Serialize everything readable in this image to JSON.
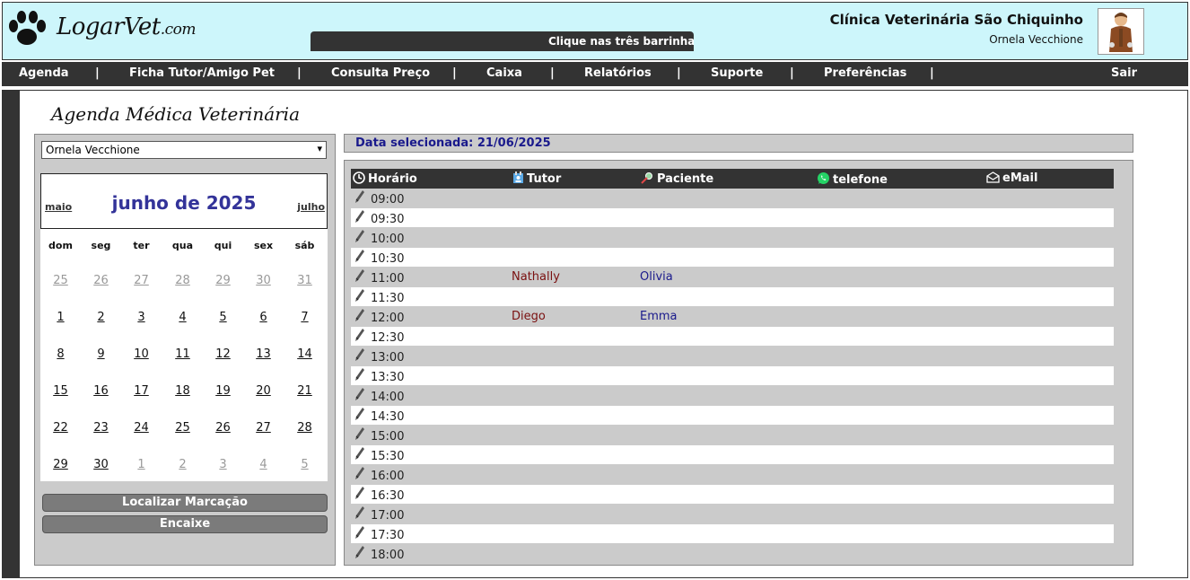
{
  "header": {
    "logo_text": "LogarVet",
    "logo_suffix": ".com",
    "ticker": "Clique nas três barrinhas pa",
    "clinic_name": "Clínica Veterinária São Chiquinho",
    "user_name": "Ornela Vecchione",
    "avatar_icon": "saint-francis-avatar"
  },
  "nav": {
    "items": [
      "Agenda",
      "Ficha Tutor/Amigo Pet",
      "Consulta Preço",
      "Caixa",
      "Relatórios",
      "Suporte",
      "Preferências"
    ],
    "separator": "|",
    "logout": "Sair"
  },
  "page": {
    "title": "Agenda Médica Veterinária"
  },
  "left": {
    "vet_selected": "Ornela Vecchione",
    "calendar": {
      "prev": "maio",
      "next": "julho",
      "title": "junho de 2025",
      "weekdays": [
        "dom",
        "seg",
        "ter",
        "qua",
        "qui",
        "sex",
        "sáb"
      ],
      "weeks": [
        [
          "25",
          "26",
          "27",
          "28",
          "29",
          "30",
          "31"
        ],
        [
          "1",
          "2",
          "3",
          "4",
          "5",
          "6",
          "7"
        ],
        [
          "8",
          "9",
          "10",
          "11",
          "12",
          "13",
          "14"
        ],
        [
          "15",
          "16",
          "17",
          "18",
          "19",
          "20",
          "21"
        ],
        [
          "22",
          "23",
          "24",
          "25",
          "26",
          "27",
          "28"
        ],
        [
          "29",
          "30",
          "1",
          "2",
          "3",
          "4",
          "5"
        ]
      ]
    },
    "btn_locate": "Localizar Marcação",
    "btn_fit": "Encaixe"
  },
  "schedule": {
    "selected_date": "Data selecionada: 21/06/2025",
    "columns": {
      "time": "Horário",
      "tutor": "Tutor",
      "patient": "Paciente",
      "phone": "telefone",
      "email": "eMail"
    },
    "rows": [
      {
        "time": "09:00",
        "tutor": "",
        "patient": ""
      },
      {
        "time": "09:30",
        "tutor": "",
        "patient": ""
      },
      {
        "time": "10:00",
        "tutor": "",
        "patient": ""
      },
      {
        "time": "10:30",
        "tutor": "",
        "patient": ""
      },
      {
        "time": "11:00",
        "tutor": "Nathally",
        "patient": "Olivia"
      },
      {
        "time": "11:30",
        "tutor": "",
        "patient": ""
      },
      {
        "time": "12:00",
        "tutor": "Diego",
        "patient": "Emma"
      },
      {
        "time": "12:30",
        "tutor": "",
        "patient": ""
      },
      {
        "time": "13:00",
        "tutor": "",
        "patient": ""
      },
      {
        "time": "13:30",
        "tutor": "",
        "patient": ""
      },
      {
        "time": "14:00",
        "tutor": "",
        "patient": ""
      },
      {
        "time": "14:30",
        "tutor": "",
        "patient": ""
      },
      {
        "time": "15:00",
        "tutor": "",
        "patient": ""
      },
      {
        "time": "15:30",
        "tutor": "",
        "patient": ""
      },
      {
        "time": "16:00",
        "tutor": "",
        "patient": ""
      },
      {
        "time": "16:30",
        "tutor": "",
        "patient": ""
      },
      {
        "time": "17:00",
        "tutor": "",
        "patient": ""
      },
      {
        "time": "17:30",
        "tutor": "",
        "patient": ""
      },
      {
        "time": "18:00",
        "tutor": "",
        "patient": ""
      }
    ]
  }
}
